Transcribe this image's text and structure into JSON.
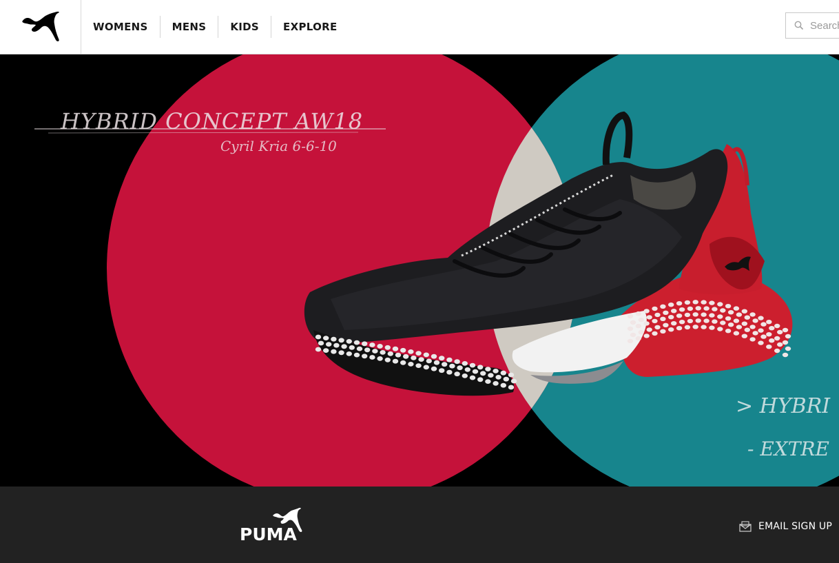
{
  "header": {
    "nav": [
      {
        "label": "WOMENS"
      },
      {
        "label": "MENS"
      },
      {
        "label": "KIDS"
      },
      {
        "label": "EXPLORE"
      }
    ],
    "search": {
      "placeholder": "Search"
    }
  },
  "hero": {
    "sketch_title": "HYBRID CONCEPT AW18",
    "sketch_subtitle": "Cyril Kria 6-6-10",
    "sketch_note_1": "> HYBRI",
    "sketch_note_2": "- EXTRE",
    "colors": {
      "background": "#000000",
      "red_circle": "#c5123a",
      "teal_circle": "#17858d",
      "overlap": "#cfcac2"
    }
  },
  "footer": {
    "brand": "PUMA",
    "email_signup_label": "EMAIL SIGN UP",
    "background": "#222222"
  }
}
